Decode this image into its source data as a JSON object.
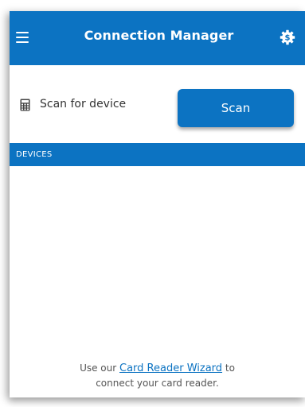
{
  "header": {
    "title": "Connection Manager",
    "menu_icon": "hamburger-menu-icon",
    "settings_icon": "gear-icon",
    "color": "#0c73c2"
  },
  "scan": {
    "label": "Scan for device",
    "icon": "calculator-icon",
    "button_label": "Scan"
  },
  "devices": {
    "section_title": "DEVICES",
    "items": []
  },
  "footer": {
    "prefix": "Use our",
    "link_text": "Card Reader Wizard",
    "suffix": "to",
    "line2": "connect your card reader.",
    "link_color": "#0c73c2"
  }
}
